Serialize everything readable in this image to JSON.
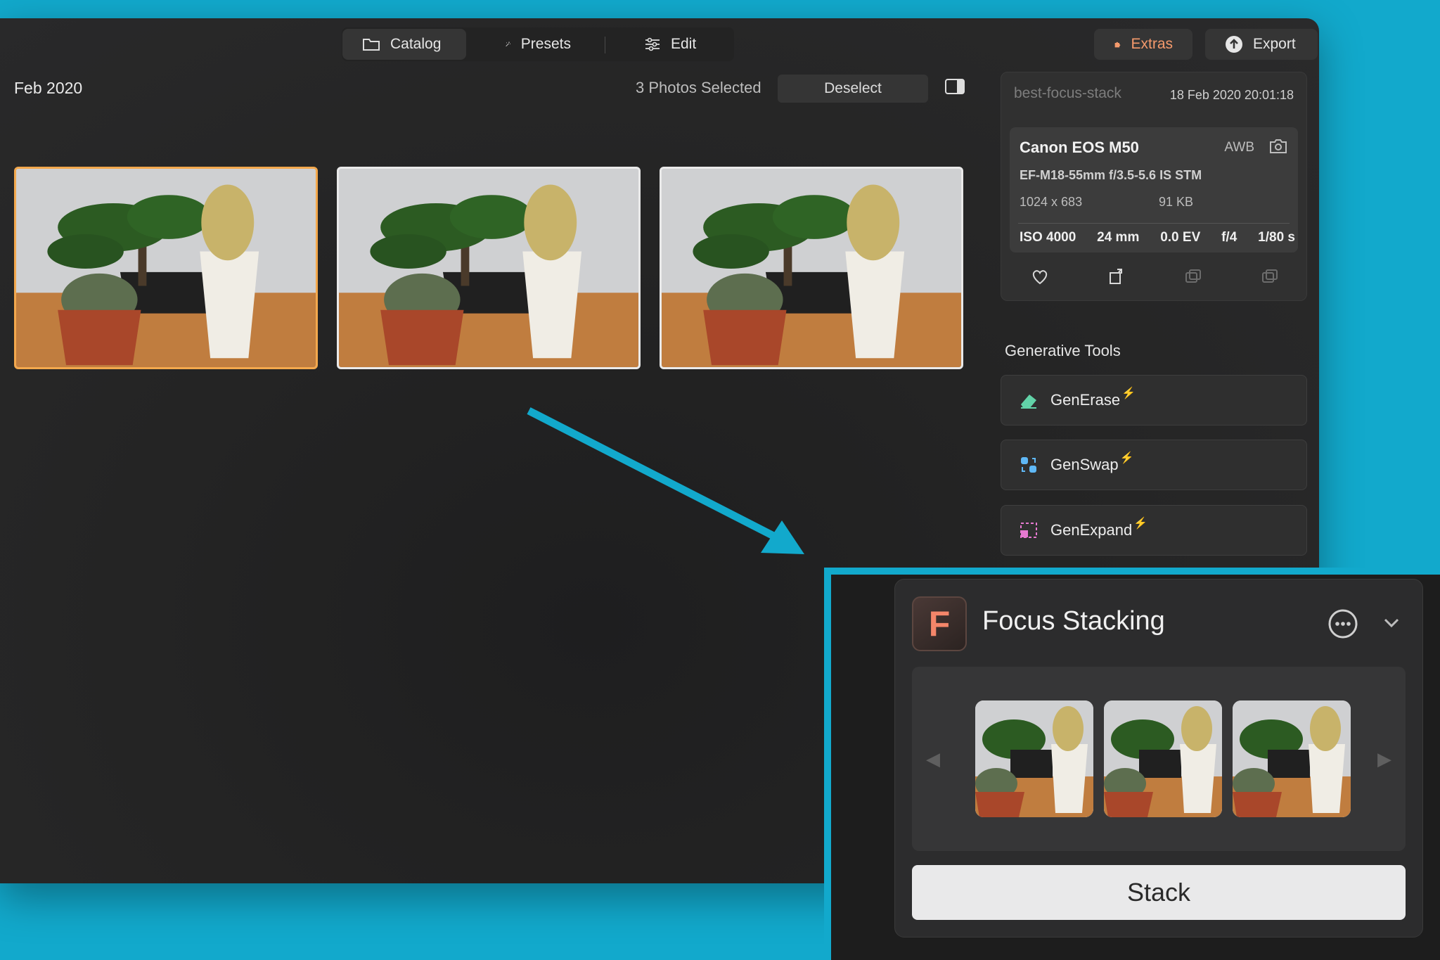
{
  "toolbar": {
    "catalog": "Catalog",
    "presets": "Presets",
    "edit": "Edit",
    "extras": "Extras",
    "export": "Export"
  },
  "page": {
    "title": "Feb 2020",
    "selected": "3 Photos Selected",
    "deselect": "Deselect"
  },
  "info": {
    "file_name": "best-focus-stack",
    "date": "18 Feb 2020 20:01:18",
    "camera": "Canon EOS M50",
    "white_balance": "AWB",
    "lens": "EF-M18-55mm f/3.5-5.6 IS STM",
    "dimensions": "1024 x 683",
    "file_size": "91 KB",
    "exif": [
      "ISO 4000",
      "24 mm",
      "0.0 EV",
      "f/4",
      "1/80 s"
    ]
  },
  "generative": {
    "title": "Generative Tools",
    "tools": [
      "GenErase",
      "GenSwap",
      "GenExpand"
    ]
  },
  "focus_stacking": {
    "logo_letter": "F",
    "title": "Focus Stacking",
    "stack_button": "Stack"
  },
  "colors": {
    "accent_orange": "#f3a84d",
    "extras_orange": "#f59a6c",
    "arrow_blue": "#12a9cc"
  }
}
